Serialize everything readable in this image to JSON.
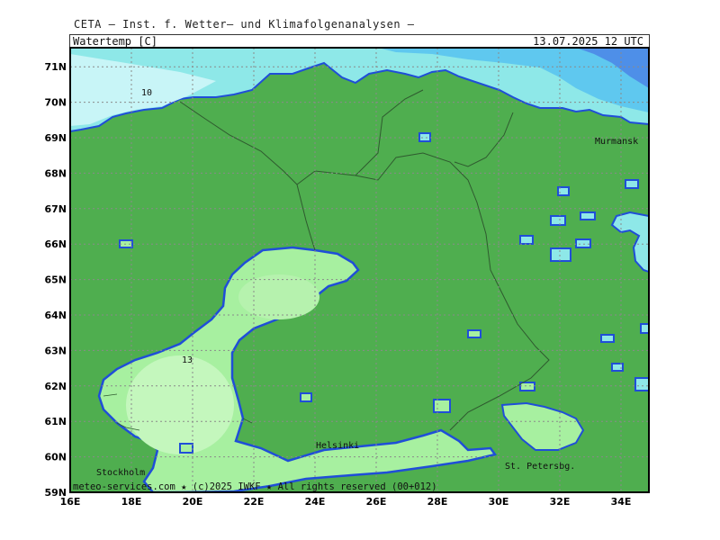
{
  "header": {
    "title": "CETA — Inst. f. Wetter— und Klimafolgenanalysen —",
    "variable": "Watertemp_[C]",
    "datetime": "13.07.2025  12 UTC"
  },
  "map": {
    "lat_labels": [
      "59N",
      "60N",
      "61N",
      "62N",
      "63N",
      "64N",
      "65N",
      "66N",
      "67N",
      "68N",
      "69N",
      "70N",
      "71N"
    ],
    "lon_labels": [
      "16E",
      "18E",
      "20E",
      "22E",
      "24E",
      "26E",
      "28E",
      "30E",
      "32E",
      "34E"
    ],
    "cities": {
      "murmansk": "Murmansk",
      "helsinki": "Helsinki",
      "stockholm": "Stockholm",
      "st_petersburg": "St. Petersbg."
    },
    "contour_labels": {
      "north": "10",
      "bothnia": "13"
    },
    "footer": "meteo-services.com ★ (c)2025 IWKF ★ All rights reserved (00+012)",
    "colors": {
      "land": "#4fae4f",
      "water_warm": "#a7f0a0",
      "water_warm_light": "#c4f7bd",
      "water_cold": "#8ee8e8",
      "water_colder": "#5fc8ef",
      "water_coldest": "#4e8fe8",
      "coast_blue": "#1f4ed8"
    }
  }
}
